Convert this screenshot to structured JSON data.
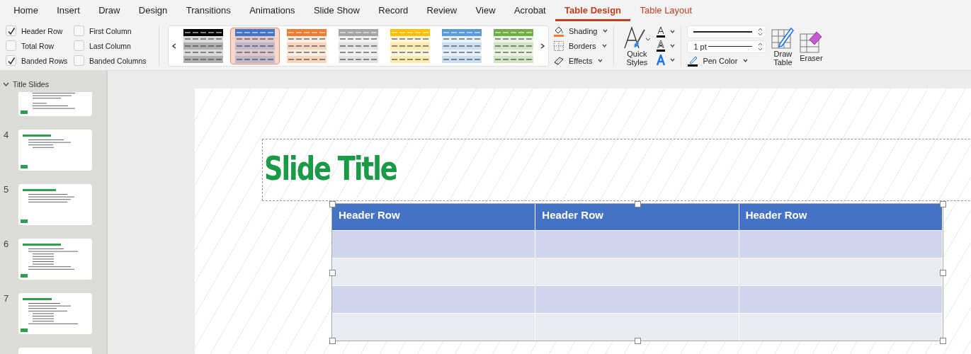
{
  "tabs": [
    {
      "label": "Home",
      "selected": false,
      "contextual": false
    },
    {
      "label": "Insert",
      "selected": false,
      "contextual": false
    },
    {
      "label": "Draw",
      "selected": false,
      "contextual": false
    },
    {
      "label": "Design",
      "selected": false,
      "contextual": false
    },
    {
      "label": "Transitions",
      "selected": false,
      "contextual": false
    },
    {
      "label": "Animations",
      "selected": false,
      "contextual": false
    },
    {
      "label": "Slide Show",
      "selected": false,
      "contextual": false
    },
    {
      "label": "Record",
      "selected": false,
      "contextual": false
    },
    {
      "label": "Review",
      "selected": false,
      "contextual": false
    },
    {
      "label": "View",
      "selected": false,
      "contextual": false
    },
    {
      "label": "Acrobat",
      "selected": false,
      "contextual": false
    },
    {
      "label": "Table Design",
      "selected": true,
      "contextual": true
    },
    {
      "label": "Table Layout",
      "selected": false,
      "contextual": true
    }
  ],
  "style_options": [
    {
      "label": "Header Row",
      "checked": true
    },
    {
      "label": "Total Row",
      "checked": false
    },
    {
      "label": "Banded Rows",
      "checked": true
    },
    {
      "label": "First Column",
      "checked": false
    },
    {
      "label": "Last Column",
      "checked": false
    },
    {
      "label": "Banded Columns",
      "checked": false
    }
  ],
  "table_styles": [
    {
      "color": "#000000",
      "selected": false
    },
    {
      "color": "#4472c4",
      "selected": true
    },
    {
      "color": "#ed7d31",
      "selected": false
    },
    {
      "color": "#a5a5a5",
      "selected": false
    },
    {
      "color": "#ffc000",
      "selected": false
    },
    {
      "color": "#5b9bd5",
      "selected": false
    },
    {
      "color": "#70ad47",
      "selected": false
    }
  ],
  "fill_buttons": [
    {
      "kind": "shading",
      "label": "Shading"
    },
    {
      "kind": "borders",
      "label": "Borders"
    },
    {
      "kind": "effects",
      "label": "Effects"
    }
  ],
  "quick_styles": {
    "label": "Quick Styles"
  },
  "pen_weight": {
    "value": "1 pt"
  },
  "pen_color": {
    "label": "Pen Color"
  },
  "draw_buttons": [
    {
      "kind": "draw",
      "label": "Draw Table"
    },
    {
      "kind": "eraser",
      "label": "Eraser"
    }
  ],
  "sidebar": {
    "section": {
      "label": "Title Slides"
    },
    "slides": [
      {
        "number": "4"
      },
      {
        "number": "5"
      },
      {
        "number": "6"
      },
      {
        "number": "7"
      }
    ]
  },
  "slide": {
    "title": "Slide Title",
    "table": {
      "headers": [
        "Header Row",
        "Header Row",
        "Header Row"
      ],
      "rows": [
        {
          "shaded": true
        },
        {
          "shaded": false
        },
        {
          "shaded": true
        },
        {
          "shaded": false
        }
      ]
    }
  }
}
